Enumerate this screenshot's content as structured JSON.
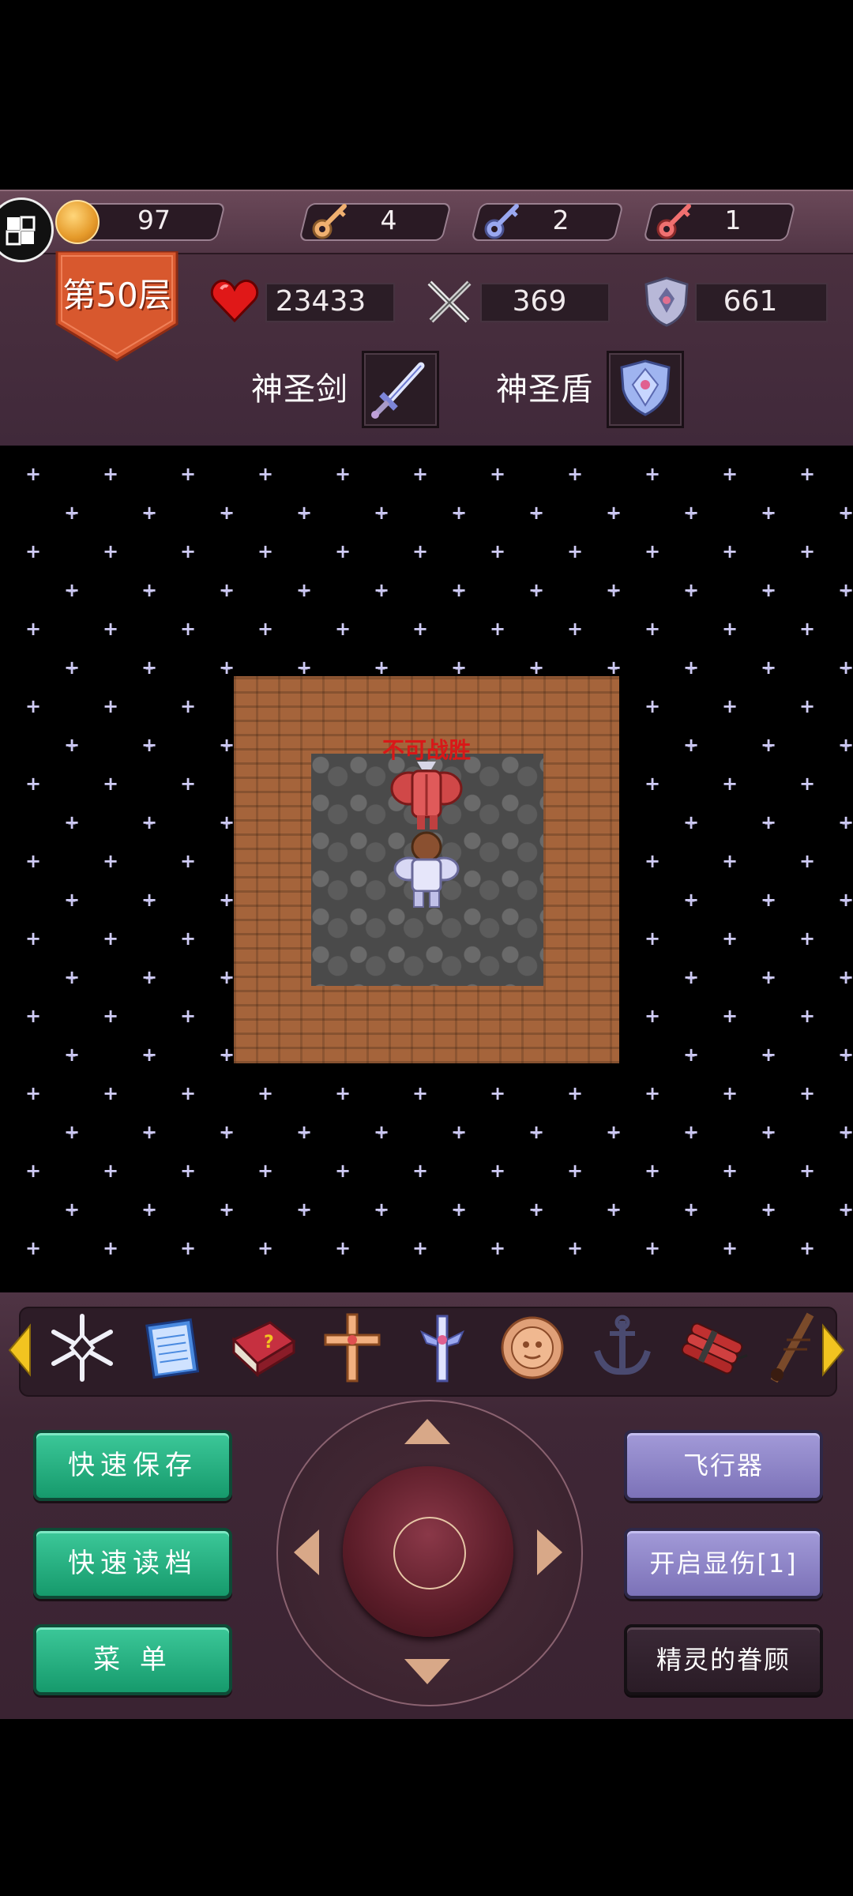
{
  "resources": {
    "gold": "97",
    "yellow_keys": "4",
    "blue_keys": "2",
    "red_keys": "1"
  },
  "floor_label": "第50层",
  "stats": {
    "hp": "23433",
    "attack": "369",
    "defense": "661"
  },
  "equipment": {
    "weapon_label": "神圣剑",
    "shield_label": "神圣盾"
  },
  "map": {
    "monster_note": "不可战胜"
  },
  "buttons": {
    "quick_save": "快速保存",
    "quick_load": "快速读档",
    "menu": "菜 单",
    "flyer": "飞行器",
    "show_damage": "开启显伤[1]",
    "fairy_favor": "精灵的眷顾"
  },
  "items": [
    "snowflake-icon",
    "notepad-icon",
    "monster-manual-icon",
    "holy-cross-icon",
    "holy-sword-charm-icon",
    "medal-icon",
    "anchor-icon",
    "dynamite-icon",
    "staff-icon"
  ],
  "colors": {
    "gold": "#f2a43a",
    "yellow_key": "#f0b070",
    "blue_key": "#9aa8f0",
    "red_key": "#f07070",
    "floor_badge": "#d8582e",
    "green_button": "#22b07e",
    "purple_button": "#8e86c8",
    "dark_button": "#2e202a",
    "warning_text": "#d81818"
  }
}
